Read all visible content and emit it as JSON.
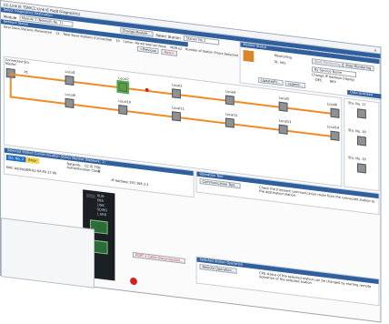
{
  "window": {
    "title": "CC-Link IE TSN/CC-Link IE Field Diagnostics",
    "close": "×"
  },
  "header": {
    "select_label": "Select Diagnostics Destination",
    "module_label": "Module",
    "module_value": "Module 1 (Network No. 1)",
    "change_module_btn": "Change Module...",
    "select_station_label": "Select Station",
    "station_value": "Station No.2",
    "network_status_title": "Network Status",
    "stat1_label": "Total Slave Stations (Parameter)",
    "stat1_value": "12",
    "stat2_label": "Total Slave Stations (Connected)",
    "stat2_value": "10",
    "stat3_label": "Comm. Period Interval Value",
    "stat3_value": "3638 μs",
    "stat4_label": "Number of Station Errors Detected",
    "stat4_value": "2",
    "prev_btn": "<Previous",
    "next_btn": "Next>"
  },
  "monitor": {
    "title": "Monitor Status",
    "monitoring": "Monitoring",
    "start_btn": "Start Monitoring",
    "stop_btn": "Stop Monitoring",
    "view": "St. Info",
    "by_service": "By Service Name",
    "change_ip": "Change IP Address Display",
    "dec": "DEC",
    "hex": "HEX",
    "update_btn": "Update(R)...",
    "legend_btn": "Legend...",
    "data_unlinked": "Data Unlinked"
  },
  "map": {
    "connected_label": "Connected Sta.",
    "master": "Master",
    "p1": "P1",
    "top_nodes": [
      "Local1",
      "Local2",
      "Local3",
      "Local4",
      "Local5",
      "Local6"
    ],
    "bottom_nodes": [
      "Local9",
      "Local10",
      "Local11",
      "Local12",
      "Local13",
      "Local14"
    ],
    "side_nodes": [
      "Sta. No. 17",
      "Sta. No. 18",
      "Sta. No. 19"
    ]
  },
  "selected_station": {
    "title": "Selected Station Communication Status Monitor (Network: 1)",
    "station": "Sta. No. 2",
    "status": "Error",
    "network_label": "Network:",
    "network_value": "CC IE TSN",
    "auth_label": "Authentication Class:",
    "auth_value": "B",
    "mac_label": "MAC Address:",
    "mac_value": "08-62-6A-F6-27-0E",
    "ip_label": "IP Address:",
    "ip_value": "192.168.3.2",
    "port_msg": "PORT 2 Cable Disconnected..."
  },
  "operation_test": {
    "title": "Operation Test",
    "btn": "Communication Test...",
    "desc": "Check the transient communication route from the connected station to the destination station."
  },
  "selected_operation": {
    "title": "Selected Station Operation",
    "btn": "Remote Operation...",
    "desc": "CPU status of the selected station can be changed by starting remote operation of the selected station."
  },
  "plc": {
    "run": "RUN",
    "err": "ERR",
    "link": "LINK",
    "sd": "SD/RD",
    "l_err": "L ERR"
  }
}
